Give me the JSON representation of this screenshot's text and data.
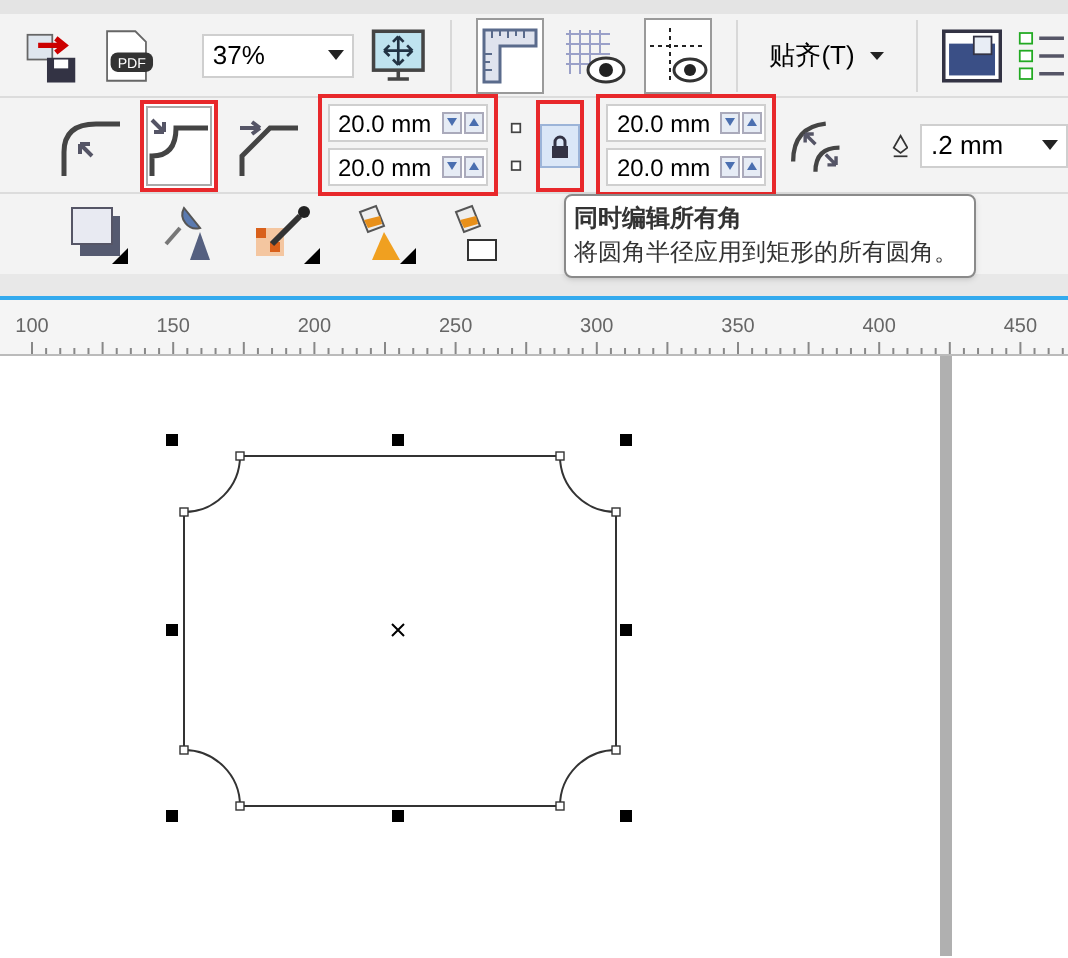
{
  "toolbar_1": {
    "pdf_label": "PDF",
    "zoom": "37%",
    "snap_menu": "贴齐(T)",
    "toggles": [
      {
        "kind": "rulers",
        "selected": true
      },
      {
        "kind": "grid",
        "selected": false
      },
      {
        "kind": "guidelines",
        "selected": true
      }
    ]
  },
  "corner_toolbar": {
    "corner_types": [
      {
        "kind": "round",
        "selected": false,
        "highlighted": false
      },
      {
        "kind": "scallop",
        "selected": true,
        "highlighted": true
      },
      {
        "kind": "chamfer",
        "selected": false,
        "highlighted": false
      }
    ],
    "radius_left": {
      "values": [
        "20.0 mm",
        "20.0 mm"
      ],
      "highlighted": true
    },
    "lock": {
      "selected": true,
      "highlighted": true
    },
    "radius_right": {
      "values": [
        "20.0 mm",
        "20.0 mm"
      ],
      "highlighted": true
    },
    "outline_width": ".2 mm"
  },
  "tooltip": {
    "title": "同时编辑所有角",
    "text": "将圆角半径应用到矩形的所有圆角。"
  },
  "ruler": {
    "labels": [
      "100",
      "150",
      "200",
      "250",
      "300",
      "350",
      "400",
      "450"
    ]
  }
}
